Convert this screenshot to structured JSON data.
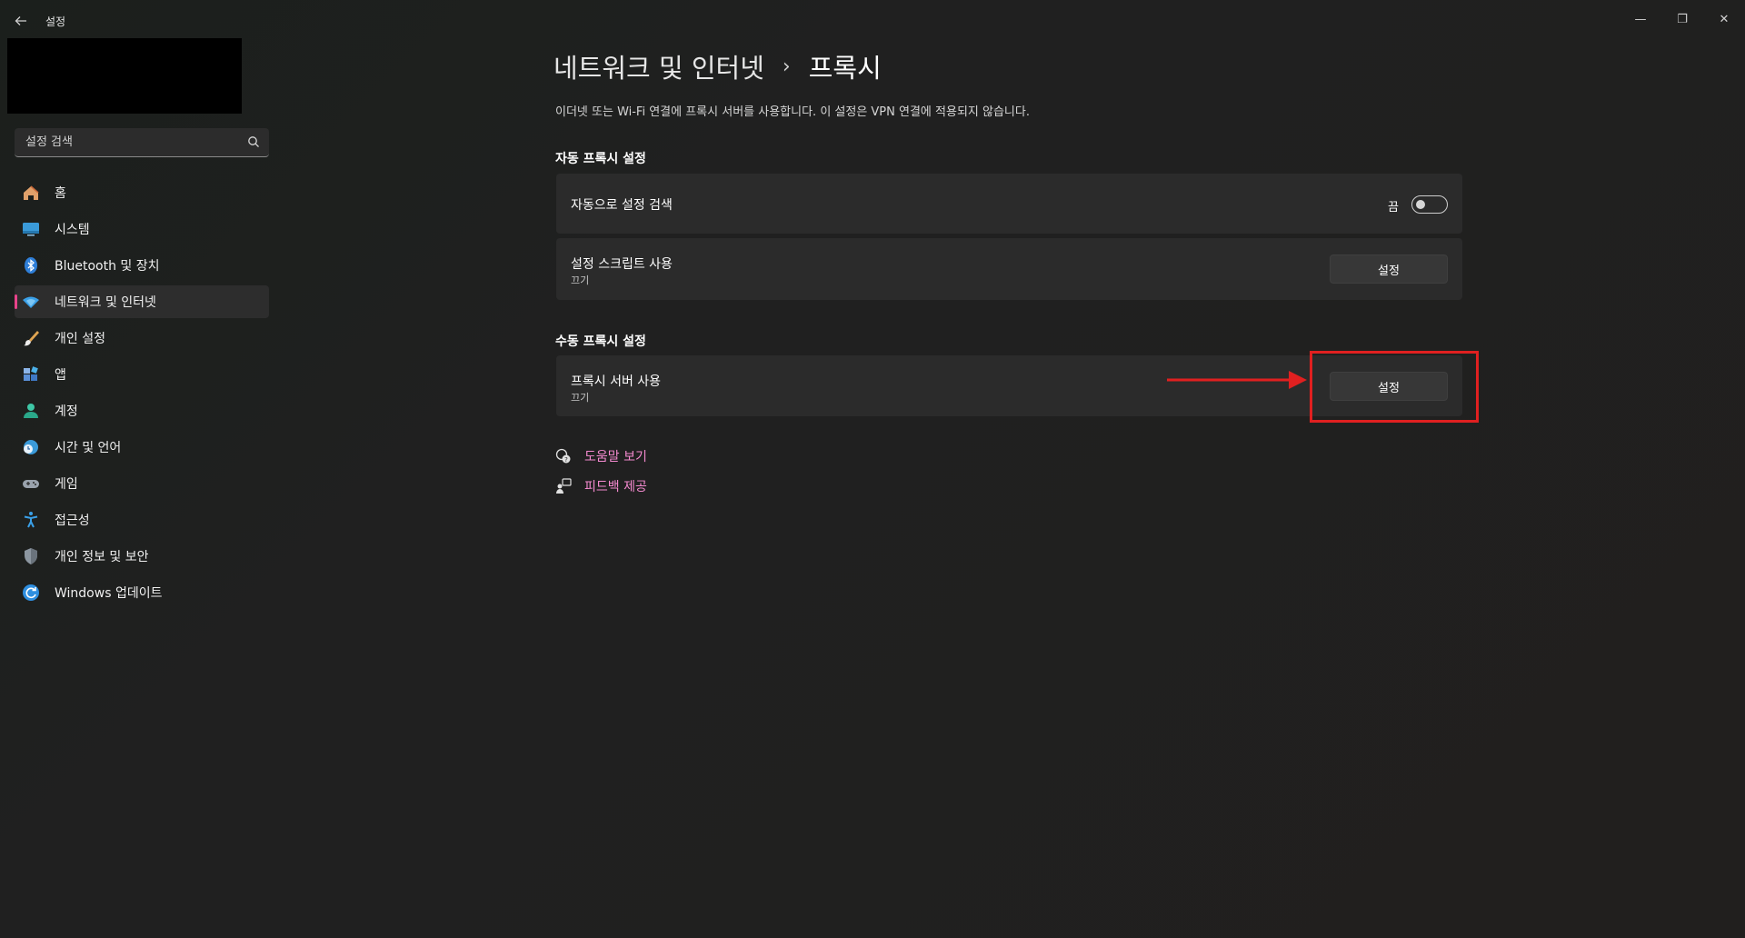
{
  "window": {
    "title": "설정",
    "controls": {
      "minimize": "—",
      "maximize": "❐",
      "close": "✕"
    }
  },
  "sidebar": {
    "search": {
      "placeholder": "설정 검색"
    },
    "items": [
      {
        "label": "홈",
        "icon": "home-icon"
      },
      {
        "label": "시스템",
        "icon": "system-icon"
      },
      {
        "label": "Bluetooth 및 장치",
        "icon": "bluetooth-icon"
      },
      {
        "label": "네트워크 및 인터넷",
        "icon": "wifi-icon",
        "active": true
      },
      {
        "label": "개인 설정",
        "icon": "brush-icon"
      },
      {
        "label": "앱",
        "icon": "apps-icon"
      },
      {
        "label": "계정",
        "icon": "account-icon"
      },
      {
        "label": "시간 및 언어",
        "icon": "globe-clock-icon"
      },
      {
        "label": "게임",
        "icon": "gamepad-icon"
      },
      {
        "label": "접근성",
        "icon": "accessibility-icon"
      },
      {
        "label": "개인 정보 및 보안",
        "icon": "shield-icon"
      },
      {
        "label": "Windows 업데이트",
        "icon": "update-icon"
      }
    ]
  },
  "main": {
    "breadcrumb": {
      "parent": "네트워크 및 인터넷",
      "separator": "›",
      "current": "프록시"
    },
    "description": "이더넷 또는 Wi-Fi 연결에 프록시 서버를 사용합니다. 이 설정은 VPN 연결에 적용되지 않습니다.",
    "auto_section": {
      "title": "자동 프록시 설정",
      "detect": {
        "label": "자동으로 설정 검색",
        "state": "끔"
      },
      "script": {
        "label": "설정 스크립트 사용",
        "sub": "끄기",
        "button": "설정"
      }
    },
    "manual_section": {
      "title": "수동 프록시 설정",
      "proxy": {
        "label": "프록시 서버 사용",
        "sub": "끄기",
        "button": "설정"
      }
    },
    "links": {
      "help": "도움말 보기",
      "feedback": "피드백 제공"
    }
  },
  "colors": {
    "accent": "#e8438a",
    "link": "#f58ad0",
    "highlight": "#e02020"
  }
}
